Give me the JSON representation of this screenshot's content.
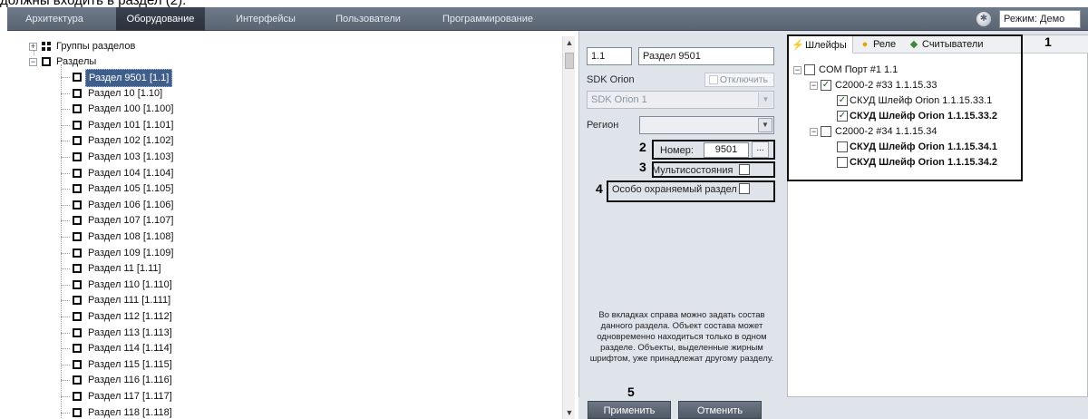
{
  "header_text": "должны входить в раздел (2).",
  "menu": {
    "items": [
      "Архитектура",
      "Оборудование",
      "Интерфейсы",
      "Пользователи",
      "Программирование"
    ],
    "active_index": 1,
    "mode_value": "Режим: Демо"
  },
  "tree": {
    "groups_label": "Группы разделов",
    "sections_label": "Разделы",
    "items": [
      "Раздел 9501 [1.1]",
      "Раздел 10 [1.10]",
      "Раздел 100 [1.100]",
      "Раздел 101 [1.101]",
      "Раздел 102 [1.102]",
      "Раздел 103 [1.103]",
      "Раздел 104 [1.104]",
      "Раздел 105 [1.105]",
      "Раздел 106 [1.106]",
      "Раздел 107 [1.107]",
      "Раздел 108 [1.108]",
      "Раздел 109 [1.109]",
      "Раздел 11 [1.11]",
      "Раздел 110 [1.110]",
      "Раздел 111 [1.111]",
      "Раздел 112 [1.112]",
      "Раздел 113 [1.113]",
      "Раздел 114 [1.114]",
      "Раздел 115 [1.115]",
      "Раздел 116 [1.116]",
      "Раздел 117 [1.117]",
      "Раздел 118 [1.118]"
    ],
    "selected_index": 0
  },
  "props": {
    "id_value": "1.1",
    "name_value": "Раздел 9501",
    "sdk_label": "SDK Orion",
    "disable_label": "Отключить",
    "sdk_select_value": "SDK Orion 1",
    "region_label": "Регион",
    "region_value": "",
    "number_label": "Номер:",
    "number_value": "9501",
    "number_button": "...",
    "multistate_label": "Мультисостояния",
    "special_label": "Особо охраняемый раздел",
    "info_text": "Во вкладках справа можно задать состав данного раздела. Объект состава может одновременно находиться только в одном разделе. Объекты, выделенные жирным шрифтом, уже принадлежат другому разделу."
  },
  "annotations": {
    "n1": "1",
    "n2": "2",
    "n3": "3",
    "n4": "4",
    "n5": "5"
  },
  "buttons": {
    "apply": "Применить",
    "cancel": "Отменить"
  },
  "right_tabs": {
    "tabs": [
      {
        "label": "Шлейфы",
        "icon": "loop-icon"
      },
      {
        "label": "Реле",
        "icon": "bulb-icon"
      },
      {
        "label": "Считыватели",
        "icon": "reader-icon"
      }
    ],
    "active_index": 0
  },
  "right_tree": {
    "com_port": "COM Порт #1 1.1",
    "device1": "С2000-2 #33 1.1.15.33",
    "d1_loop1": "СКУД Шлейф Orion 1.1.15.33.1",
    "d1_loop2": "СКУД Шлейф Orion 1.1.15.33.2",
    "device2": "С2000-2 #34 1.1.15.34",
    "d2_loop1": "СКУД Шлейф Orion 1.1.15.34.1",
    "d2_loop2": "СКУД Шлейф Orion 1.1.15.34.2"
  }
}
